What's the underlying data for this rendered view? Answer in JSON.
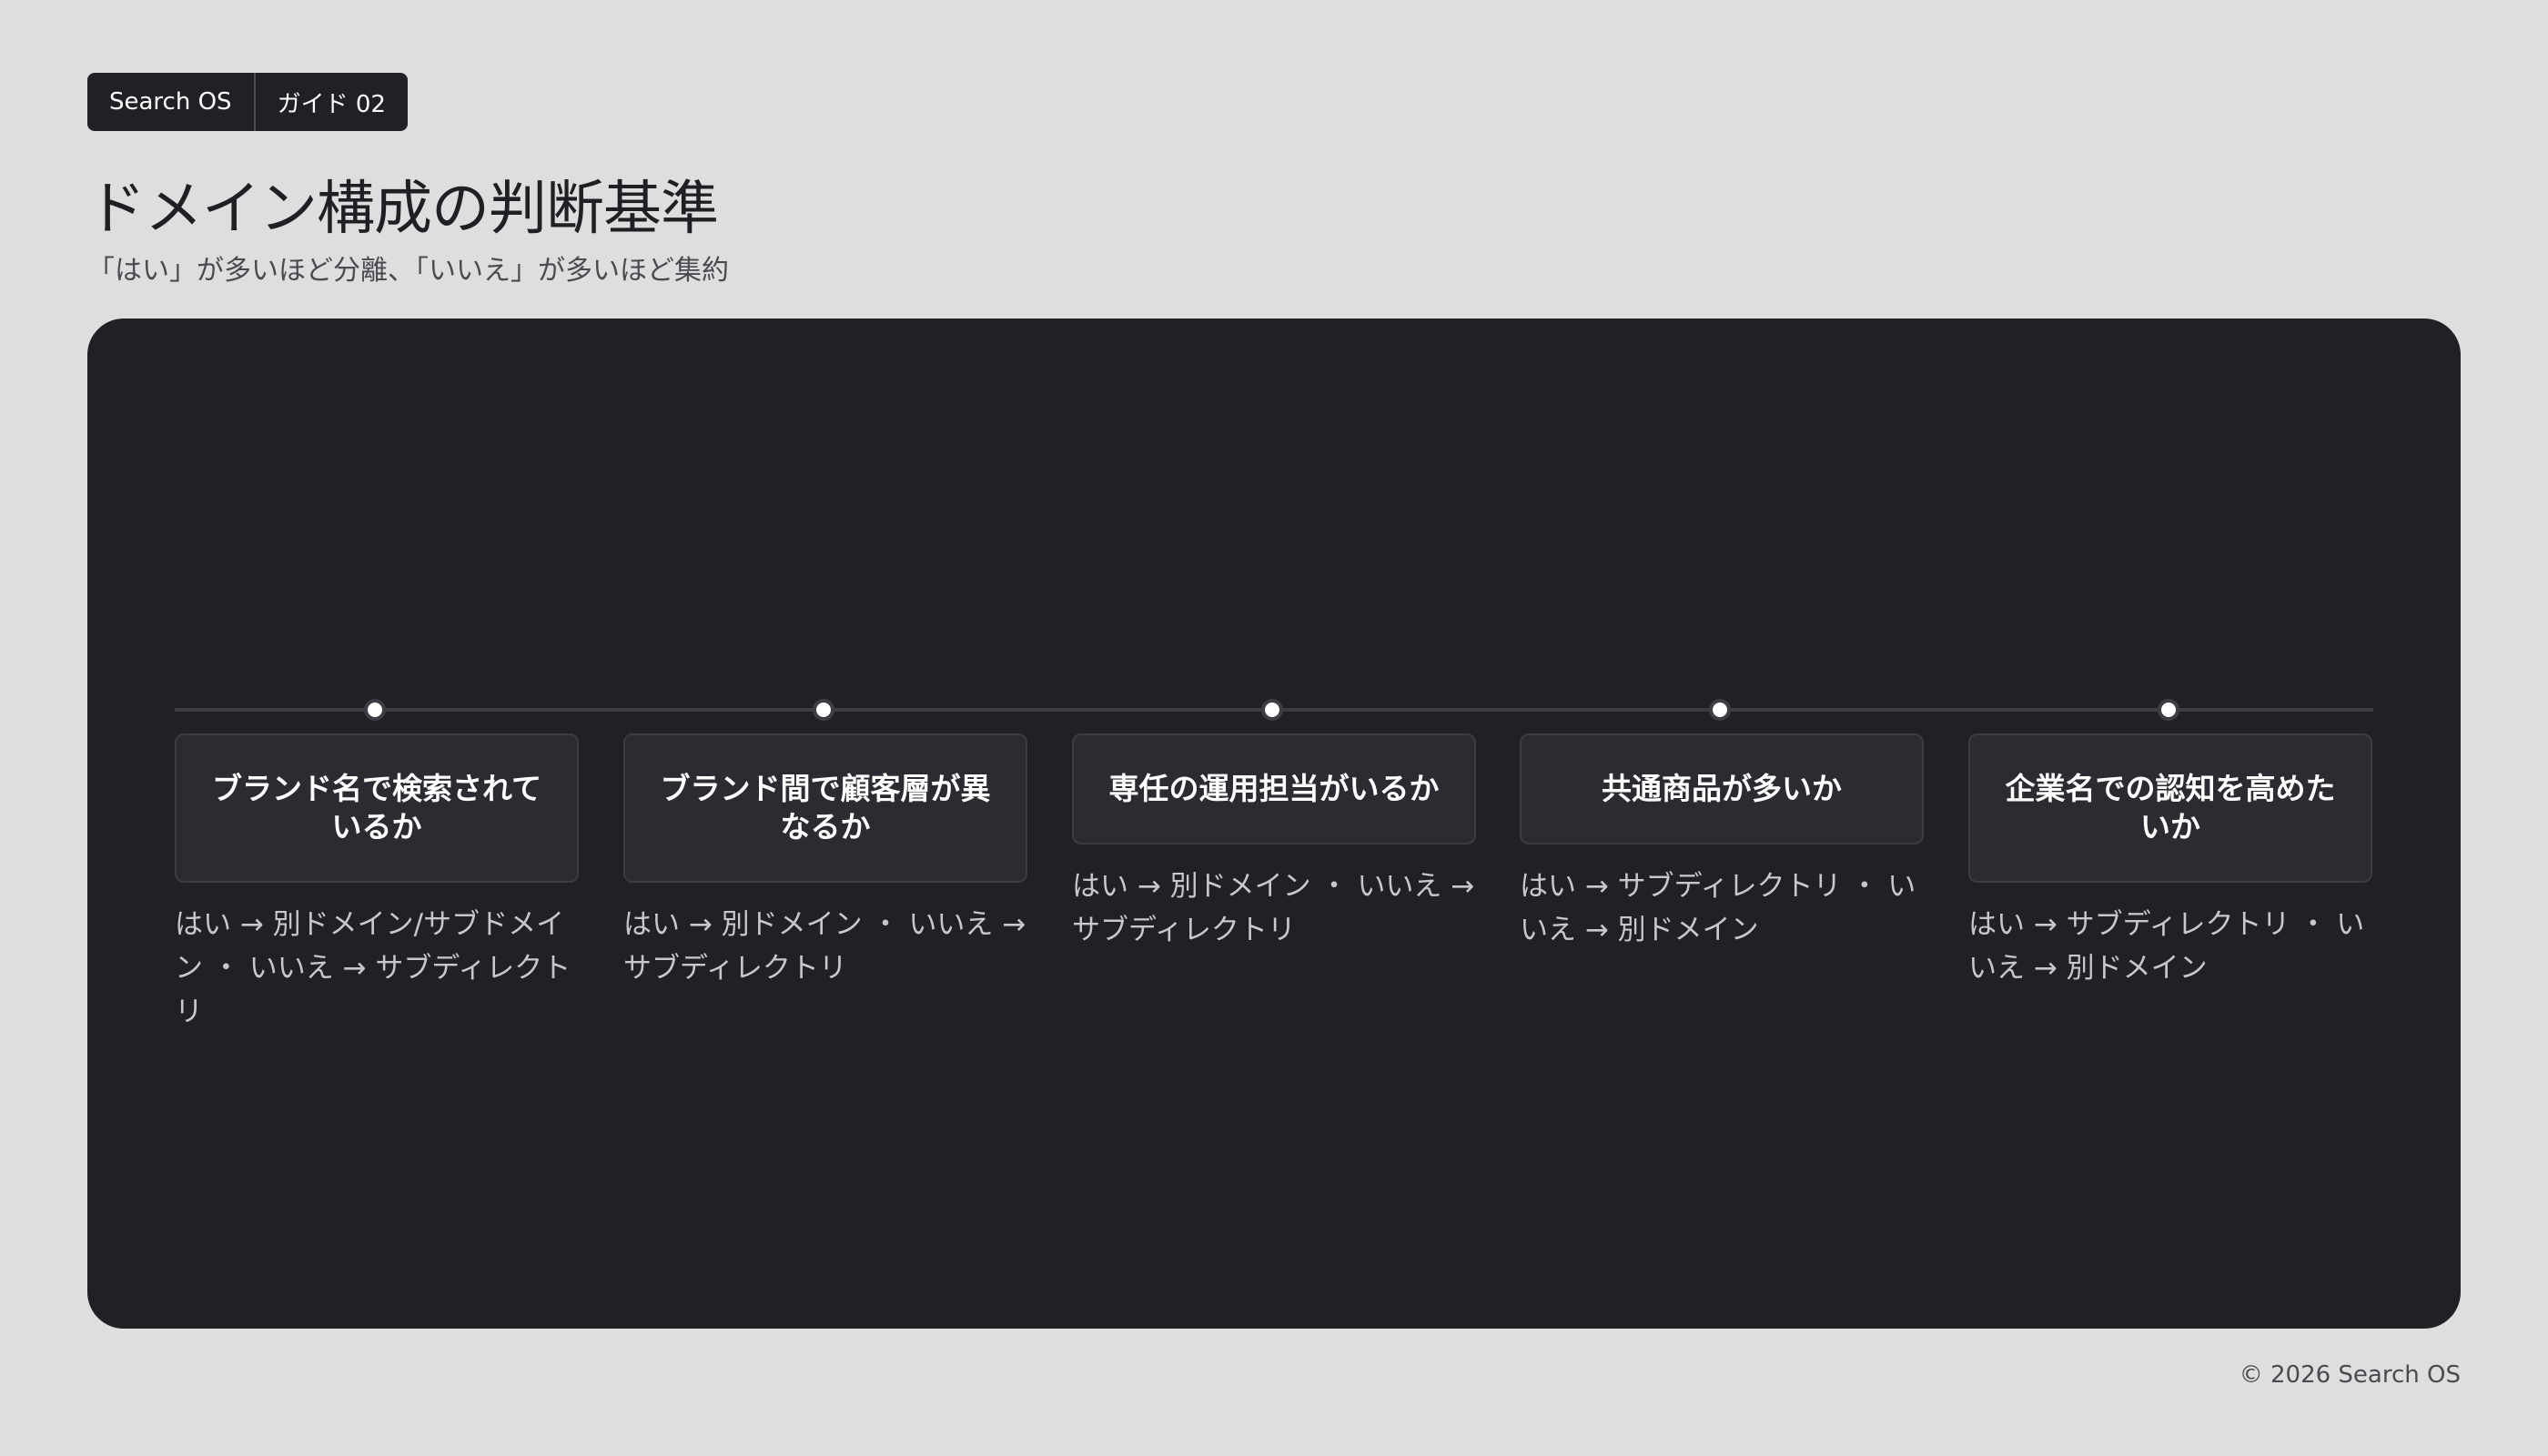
{
  "breadcrumb": [
    "Search OS",
    "ガイド 02"
  ],
  "title": "ドメイン構成の判断基準",
  "subtitle": "「はい」が多いほど分離、「いいえ」が多いほど集約",
  "steps": [
    {
      "question": "ブランド名で検索されているか",
      "note": "はい → 別ドメイン/サブドメイン ・ いいえ → サブディレクトリ"
    },
    {
      "question": "ブランド間で顧客層が異なるか",
      "note": "はい → 別ドメイン ・ いいえ → サブディレクトリ"
    },
    {
      "question": "専任の運用担当がいるか",
      "note": "はい → 別ドメイン ・ いいえ → サブディレクトリ"
    },
    {
      "question": "共通商品が多いか",
      "note": "はい → サブディレクトリ ・ いいえ → 別ドメイン"
    },
    {
      "question": "企業名での認知を高めたいか",
      "note": "はい → サブディレクトリ ・ いいえ → 別ドメイン"
    }
  ],
  "footer": "© 2026 Search OS",
  "colors": {
    "background": "#dedede",
    "panel": "#202125",
    "card": "#2a2c31",
    "node": "#ffffff"
  }
}
